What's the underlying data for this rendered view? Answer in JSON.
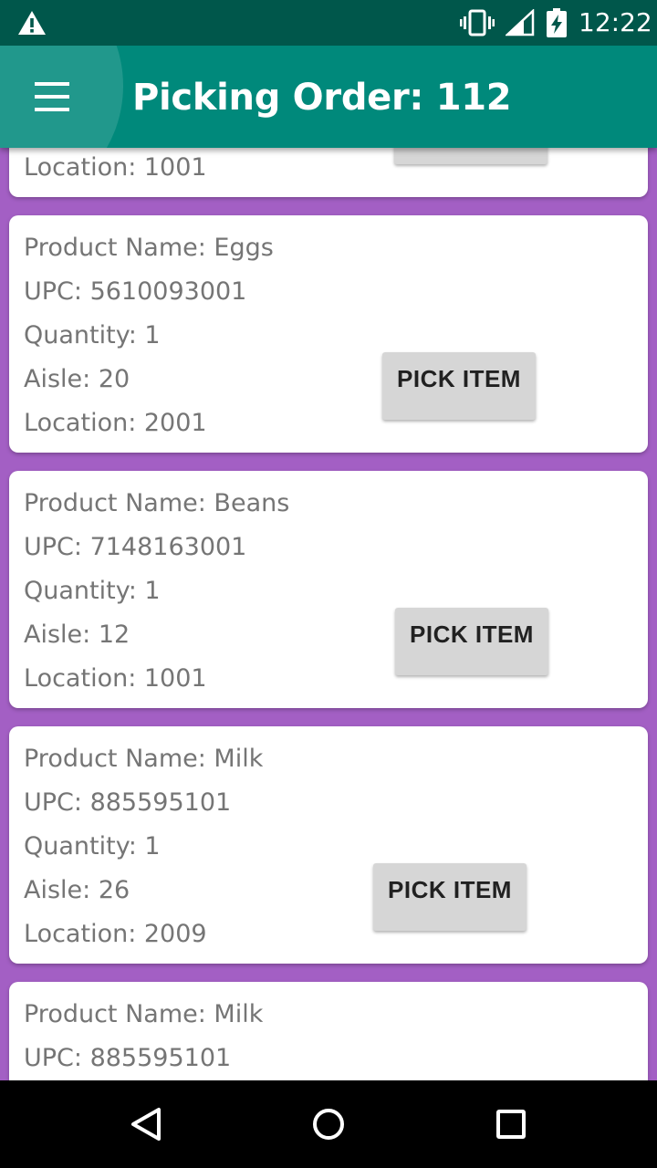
{
  "status_bar": {
    "time": "12:22",
    "icons": [
      "warning-icon",
      "vibrate-icon",
      "signal-icon",
      "battery-charging-icon"
    ]
  },
  "app_bar": {
    "menu_icon": "menu-icon",
    "title": "Picking Order: 112"
  },
  "items": [
    {
      "product_name": "",
      "upc": "",
      "quantity": "",
      "aisle": "",
      "location": "Location: 1001",
      "button": ""
    },
    {
      "product_name": "Product Name: Eggs",
      "upc": "UPC: 5610093001",
      "quantity": "Quantity: 1",
      "aisle": "Aisle: 20",
      "location": "Location: 2001",
      "button": "PICK ITEM"
    },
    {
      "product_name": "Product Name: Beans",
      "upc": "UPC: 7148163001",
      "quantity": "Quantity: 1",
      "aisle": "Aisle: 12",
      "location": "Location: 1001",
      "button": "PICK ITEM"
    },
    {
      "product_name": "Product Name: Milk",
      "upc": "UPC: 885595101",
      "quantity": "Quantity: 1",
      "aisle": "Aisle: 26",
      "location": "Location: 2009",
      "button": "PICK ITEM"
    },
    {
      "product_name": "Product Name: Milk",
      "upc": "UPC: 885595101",
      "quantity": "",
      "aisle": "",
      "location": "",
      "button": ""
    }
  ],
  "nav_bar": {
    "icons": [
      "back-icon",
      "home-icon",
      "recents-icon"
    ]
  },
  "colors": {
    "status_bar": "#00574b",
    "app_bar": "#00897b",
    "background": "#a35fc4",
    "button": "#d6d6d6"
  }
}
